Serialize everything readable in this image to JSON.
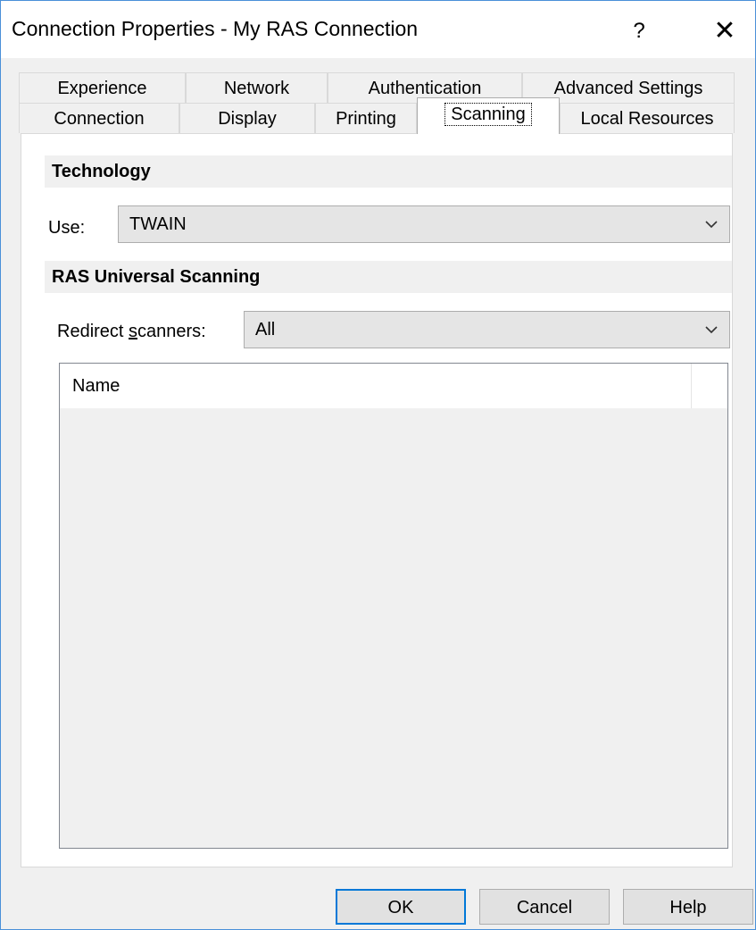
{
  "window": {
    "title": "Connection Properties - My RAS Connection",
    "help_glyph": "?",
    "close_glyph": "✕"
  },
  "tabs_row1": [
    "Experience",
    "Network",
    "Authentication",
    "Advanced Settings"
  ],
  "tabs_row2": [
    "Connection",
    "Display",
    "Printing",
    "Scanning",
    "Local Resources"
  ],
  "active_tab": "Scanning",
  "technology": {
    "header": "Technology",
    "use_label": "Use:",
    "use_value": "TWAIN"
  },
  "universal_scanning": {
    "header": "RAS Universal Scanning",
    "redirect_label_pre": "Redirect ",
    "redirect_label_accel": "s",
    "redirect_label_post": "canners:",
    "redirect_value": "All",
    "list_columns": [
      "Name"
    ]
  },
  "buttons": {
    "ok": "OK",
    "cancel": "Cancel",
    "help": "Help"
  },
  "colors": {
    "accent": "#0078d7",
    "window_border": "#4a90d9"
  },
  "icons": {
    "dropdown": "chevron-down-icon",
    "close": "close-icon",
    "help": "help-icon"
  }
}
